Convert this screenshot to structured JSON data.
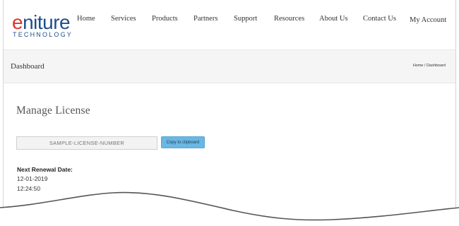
{
  "header": {
    "logo": {
      "word_first": "e",
      "word_rest": "niture",
      "subtitle": "TECHNOLOGY"
    },
    "nav": [
      {
        "label": "Home"
      },
      {
        "label": "Services"
      },
      {
        "label": "Products"
      },
      {
        "label": "Partners"
      },
      {
        "label": "Support"
      },
      {
        "label": "Resources"
      },
      {
        "label": "About Us"
      },
      {
        "label": "Contact Us"
      },
      {
        "label": "My Account"
      }
    ]
  },
  "titlebar": {
    "title": "Dashboard",
    "breadcrumb": {
      "home": "Home",
      "separator": "/",
      "current": "Dashboard"
    }
  },
  "main": {
    "section_title": "Manage License",
    "license_input": {
      "placeholder": "SAMPLE-LICENSE-NUMBER",
      "value": ""
    },
    "copy_button_label": "Copy to clipboard",
    "renewal": {
      "label": "Next Renewal Date:",
      "date": "12-01-2019",
      "time": "12:24:50"
    }
  },
  "colors": {
    "logo_blue": "#1f4e8c",
    "logo_red": "#e0352b",
    "button_blue": "#6bb7e3",
    "titlebar_bg": "#f5f5f5"
  },
  "icons": {
    "bottom_edge": "torn-paper-edge"
  }
}
